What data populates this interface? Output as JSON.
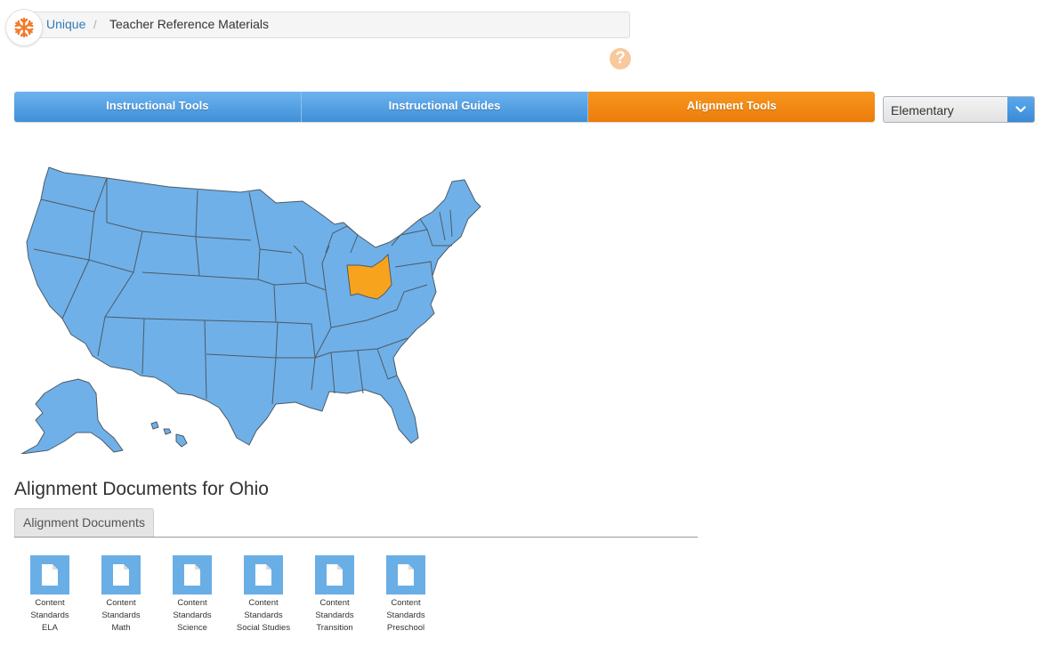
{
  "breadcrumb": {
    "logo_icon": "snowflake-icon",
    "root": "Unique",
    "separator": "/",
    "current": "Teacher Reference Materials"
  },
  "help": {
    "icon": "question-icon",
    "glyph": "?"
  },
  "tabs": [
    {
      "label": "Instructional Tools",
      "active": false
    },
    {
      "label": "Instructional Guides",
      "active": false
    },
    {
      "label": "Alignment Tools",
      "active": true
    }
  ],
  "level_select": {
    "value": "Elementary",
    "icon": "chevron-down-icon"
  },
  "map": {
    "selected_state": "Ohio",
    "default_color": "#6fb0e8",
    "selected_color": "#f7a31e"
  },
  "section": {
    "title": "Alignment Documents for Ohio",
    "tab_label": "Alignment Documents"
  },
  "documents": [
    {
      "line1": "Content",
      "line2": "Standards",
      "line3": "ELA"
    },
    {
      "line1": "Content",
      "line2": "Standards",
      "line3": "Math"
    },
    {
      "line1": "Content",
      "line2": "Standards",
      "line3": "Science"
    },
    {
      "line1": "Content",
      "line2": "Standards",
      "line3": "Social Studies"
    },
    {
      "line1": "Content",
      "line2": "Standards",
      "line3": "Transition"
    },
    {
      "line1": "Content",
      "line2": "Standards",
      "line3": "Preschool"
    }
  ],
  "colors": {
    "accent_blue": "#4a9be0",
    "accent_orange": "#f08a12",
    "link": "#337ab7"
  }
}
